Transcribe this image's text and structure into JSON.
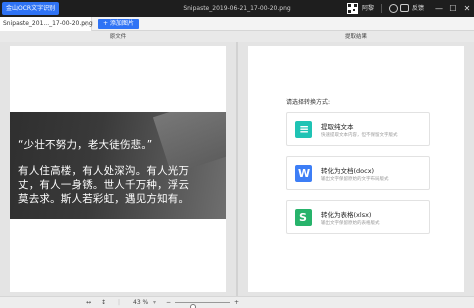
{
  "titlebar": {
    "app_name": "金山OCR文字识别",
    "document_title": "Snipaste_2019-06-21_17-00-20.png",
    "user_name": "阿黎",
    "feedback_label": "反馈",
    "minimize": "—",
    "maximize": "☐",
    "close": "✕"
  },
  "tabs": {
    "file_tab_label": "Snipaste_201..._17-00-20.png",
    "file_tab_close": "×",
    "add_image_label": "+ 添加图片"
  },
  "panels": {
    "left_header": "原文件",
    "right_header": "提取结果"
  },
  "image_text": [
    "“少壮不努力，老大徒伤悲。”",
    "有人住高楼，有人处深沟。有人光万",
    "丈，有人一身锈。世人千万种，浮云",
    "莫去求。斯人若彩虹，遇见方知有。"
  ],
  "conversion": {
    "prompt": "请选择转换方式:",
    "options": [
      {
        "title": "提取纯文本",
        "desc": "快速提取文本内容，但不保留文字版式",
        "icon": "text-lines-icon",
        "color": "#1fc3b4",
        "glyph": "≡"
      },
      {
        "title": "转化为文档(docx)",
        "desc": "输出文字保留原始的文字布局版式",
        "icon": "word-doc-icon",
        "color": "#3d7ef6",
        "glyph": "W"
      },
      {
        "title": "转化为表格(xlsx)",
        "desc": "输出文字保留原始的表格版式",
        "icon": "spreadsheet-icon",
        "color": "#27b36b",
        "glyph": "S"
      }
    ]
  },
  "statusbar": {
    "zoom_text": "43 %",
    "zoom_out": "−",
    "zoom_in": "+",
    "zoom_level": 0.43
  }
}
